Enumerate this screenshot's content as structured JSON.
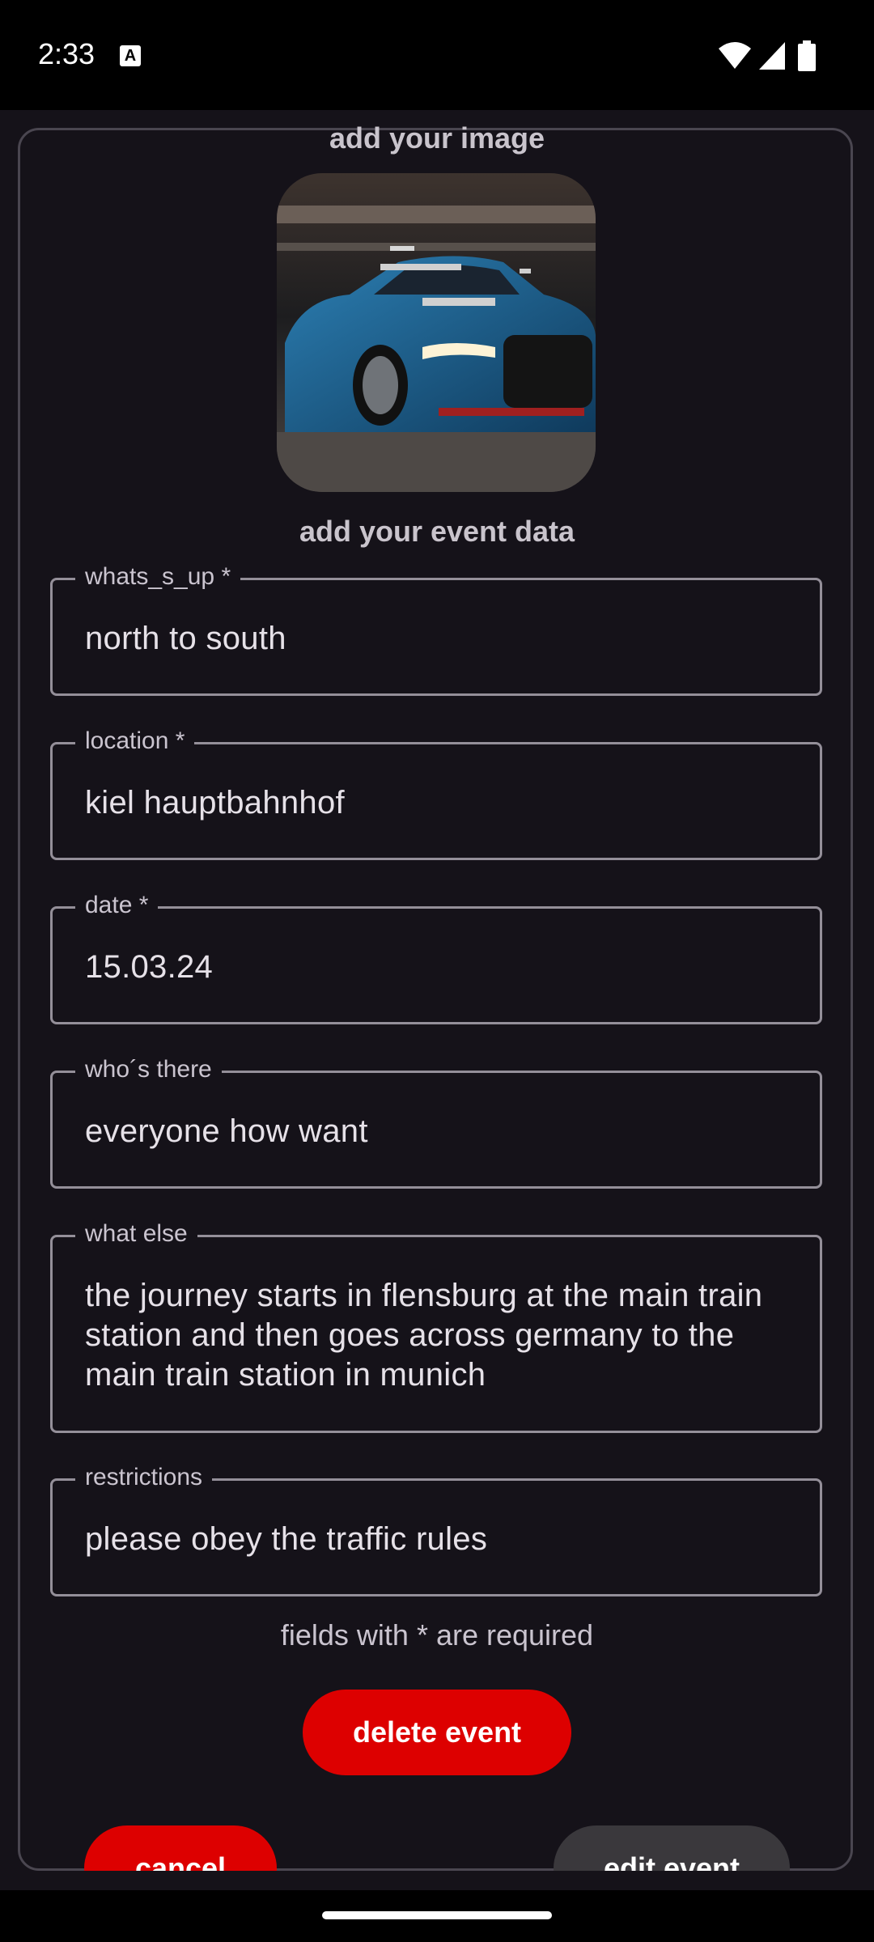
{
  "status_bar": {
    "time": "2:33",
    "notification_icon_letter": "A"
  },
  "form": {
    "image_section_title": "add your image",
    "event_section_title": "add your event data",
    "fields": [
      {
        "label": "whats_s_up *",
        "value": "north to south"
      },
      {
        "label": "location *",
        "value": "kiel hauptbahnhof"
      },
      {
        "label": "date *",
        "value": "15.03.24"
      },
      {
        "label": "who´s there",
        "value": "everyone how want"
      },
      {
        "label": "what else",
        "value": "the journey starts in flensburg at the main train station and then goes across germany to the main train station in munich"
      },
      {
        "label": "restrictions",
        "value": "please obey the traffic rules"
      }
    ],
    "required_note": "fields with * are required"
  },
  "buttons": {
    "delete": "delete event",
    "cancel": "cancel",
    "edit": "edit event"
  },
  "colors": {
    "background": "#151219",
    "danger": "#dd0000",
    "secondary_button": "#3a383c",
    "outline": "#948f99"
  },
  "icons": [
    "wifi-icon",
    "signal-icon",
    "battery-icon",
    "car-photo"
  ]
}
